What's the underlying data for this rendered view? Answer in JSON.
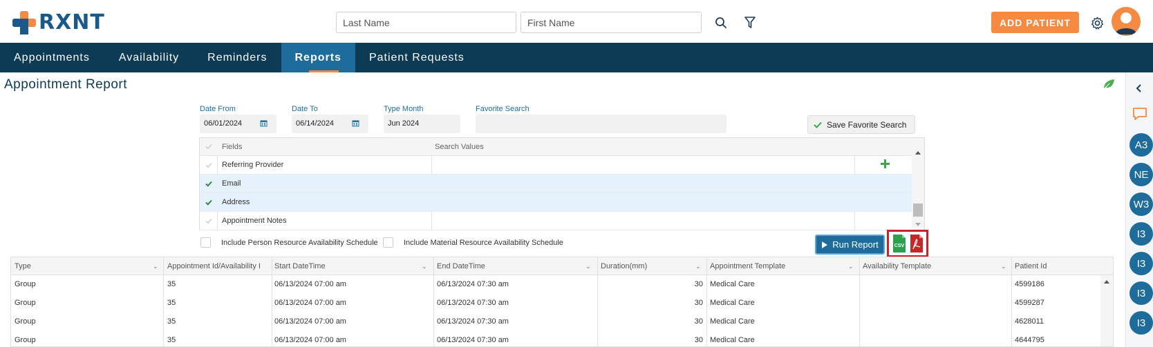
{
  "brand": {
    "name": "RXNT"
  },
  "search": {
    "last_name_placeholder": "Last Name",
    "first_name_placeholder": "First Name"
  },
  "header": {
    "add_patient_label": "ADD PATIENT"
  },
  "nav": {
    "items": [
      {
        "label": "Appointments"
      },
      {
        "label": "Availability"
      },
      {
        "label": "Reminders"
      },
      {
        "label": "Reports"
      },
      {
        "label": "Patient Requests"
      }
    ],
    "active": "Reports"
  },
  "page": {
    "title": "Appointment Report"
  },
  "filters": {
    "date_from_label": "Date From",
    "date_from_value": "06/01/2024",
    "date_to_label": "Date To",
    "date_to_value": "06/14/2024",
    "type_month_label": "Type Month",
    "type_month_value": "Jun 2024",
    "favorite_search_label": "Favorite Search",
    "favorite_search_value": "",
    "save_favorite_label": "Save Favorite Search"
  },
  "fields_grid": {
    "header_fields": "Fields",
    "header_values": "Search Values",
    "rows": [
      {
        "field": "Referring Provider",
        "checked": false
      },
      {
        "field": "Email",
        "checked": true
      },
      {
        "field": "Address",
        "checked": true
      },
      {
        "field": "Appointment Notes",
        "checked": false
      }
    ]
  },
  "options": {
    "person_schedule_label": "Include Person Resource Availability Schedule",
    "material_schedule_label": "Include Material Resource Availability Schedule"
  },
  "actions": {
    "run_report_label": "Run Report",
    "csv_label": "CSV"
  },
  "results": {
    "columns": [
      "Type",
      "Appointment Id/Availability Id",
      "Start DateTime",
      "End DateTime",
      "Duration(mm)",
      "Appointment Template",
      "Availability Template",
      "Patient Id"
    ],
    "rows": [
      [
        "Group",
        "35",
        "06/13/2024 07:00 am",
        "06/13/2024 07:30 am",
        "30",
        "Medical Care",
        "",
        "4599186"
      ],
      [
        "Group",
        "35",
        "06/13/2024 07:00 am",
        "06/13/2024 07:30 am",
        "30",
        "Medical Care",
        "",
        "4599287"
      ],
      [
        "Group",
        "35",
        "06/13/2024 07:00 am",
        "06/13/2024 07:30 am",
        "30",
        "Medical Care",
        "",
        "4628011"
      ],
      [
        "Group",
        "35",
        "06/13/2024 07:00 am",
        "06/13/2024 07:30 am",
        "30",
        "Medical Care",
        "",
        "4644795"
      ]
    ]
  },
  "rail": {
    "badges": [
      "A3",
      "NE",
      "W3",
      "I3",
      "I3",
      "I3",
      "I3"
    ]
  },
  "colors": {
    "brand_orange": "#f58a42",
    "navy": "#0d3a55",
    "blue": "#1d6c9c",
    "highlight_red": "#d0202a",
    "csv_green": "#2e9e4f"
  }
}
